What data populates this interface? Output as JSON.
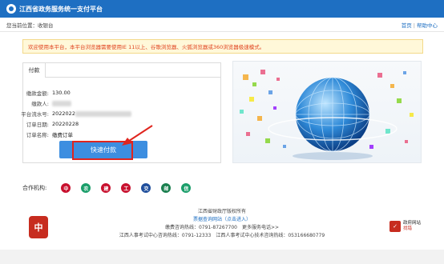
{
  "header": {
    "title": "江西省政务服务统一支付平台"
  },
  "location": {
    "current_label": "您当前位置：",
    "current_value": "收银台",
    "home_link": "首页",
    "help_link": "帮助中心"
  },
  "notice": {
    "text": "欢迎使用本平台，本平台浏览器需要使用IE 11以上、谷歌浏览器、火狐浏览器或360浏览器极速模式。"
  },
  "payment": {
    "tab_label": "付款",
    "fields": [
      {
        "label": "缴款金额:",
        "value": "130.00"
      },
      {
        "label": "缴款人:",
        "value": ""
      },
      {
        "label": "平台流水号:",
        "value": "2022022"
      },
      {
        "label": "订单日期:",
        "value": "20220228"
      },
      {
        "label": "订单名称:",
        "value": "缴费订单"
      }
    ],
    "pay_button": "快速付款"
  },
  "partners": {
    "label": "合作机构:",
    "banks": [
      {
        "icon": "boc-icon",
        "glyph": "中",
        "color": "#c8102e"
      },
      {
        "icon": "agri-icon",
        "glyph": "农",
        "color": "#1a9e6a"
      },
      {
        "icon": "ccb-icon",
        "glyph": "建",
        "color": "#c8102e"
      },
      {
        "icon": "icbc-icon",
        "glyph": "工",
        "color": "#c8102e"
      },
      {
        "icon": "bcom-icon",
        "glyph": "交",
        "color": "#1f4e9c"
      },
      {
        "icon": "post-icon",
        "glyph": "邮",
        "color": "#1a7f4f"
      },
      {
        "icon": "rcb-icon",
        "glyph": "信",
        "color": "#1a9e6a"
      }
    ]
  },
  "footer": {
    "copyright": "江西省财政厅版权所有",
    "query_link": "票据查询网站（点击进入）",
    "hotline": "缴费咨询热线：0791-87267700　更多服务电话>>",
    "exam_hotline": "江西人事考试中心咨询热线：0791-12333　江西人事考试中心技术咨询热线：053166680779",
    "emblem_text": "中",
    "gov_site_top": "政府网站",
    "gov_site_bottom": "找错"
  },
  "colors": {
    "brand": "#1e6fc2",
    "notice_text": "#e0421e",
    "button": "#3d8ee0",
    "highlight": "#e0251e"
  }
}
